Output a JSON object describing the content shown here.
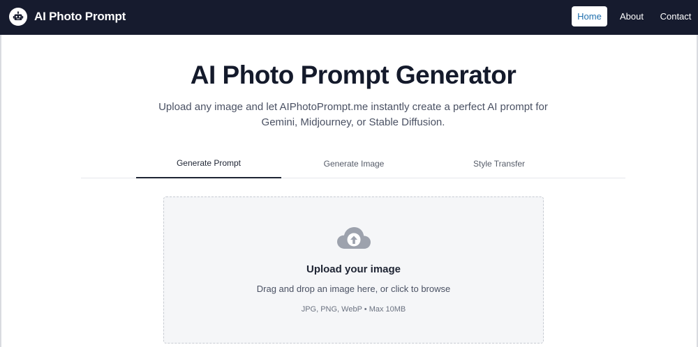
{
  "header": {
    "brand_name": "AI Photo Prompt",
    "logo_icon": "robot-icon",
    "nav": {
      "home": "Home",
      "about": "About",
      "contact": "Contact"
    },
    "background_color": "#161b2e",
    "active_nav_text_color": "#1f6fae"
  },
  "hero": {
    "title": "AI Photo Prompt Generator",
    "subtitle": "Upload any image and let AIPhotoPrompt.me instantly create a perfect AI prompt for Gemini, Midjourney, or Stable Diffusion."
  },
  "tabs": [
    {
      "label": "Generate Prompt",
      "active": true
    },
    {
      "label": "Generate Image",
      "active": false
    },
    {
      "label": "Style Transfer",
      "active": false
    }
  ],
  "upload": {
    "icon": "cloud-upload-icon",
    "title": "Upload your image",
    "description": "Drag and drop an image here, or click to browse",
    "formats": "JPG, PNG, WebP • Max 10MB"
  }
}
